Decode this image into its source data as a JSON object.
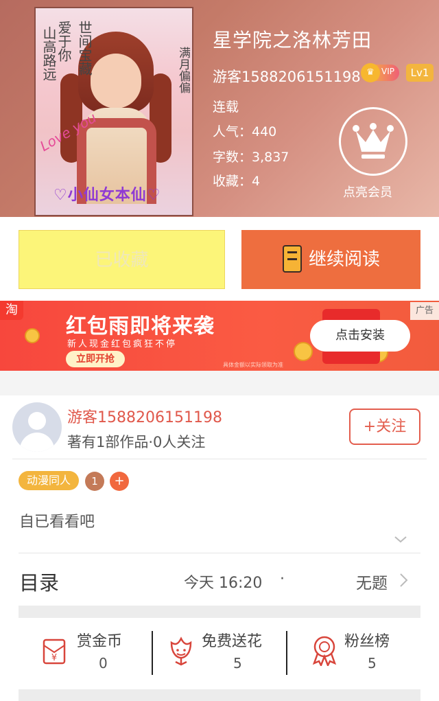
{
  "book": {
    "title": "星学院之洛林芳田",
    "author": "游客1588206151198",
    "vip_label": "VIP",
    "level": "Lv1",
    "status": "连载",
    "popularity": "人气：440",
    "word_count": "字数：3,837",
    "favorites": "收藏：4",
    "member_label": "点亮会员",
    "cover": {
      "line1": "山高路远",
      "line2": "爱于你",
      "line3": "世间宝藏",
      "line4": "满月偏偏",
      "love": "Love you",
      "banner": "♡小仙女本仙♡"
    }
  },
  "actions": {
    "collected": "已收藏",
    "continue": "继续阅读"
  },
  "ad": {
    "platform_icon": "淘",
    "headline": "红包雨即将来袭",
    "subline": "新人现金红包疯狂不停",
    "grab": "立即开抢",
    "install": "点击安装",
    "tag": "广告",
    "note": "具体金额以实际领取为准"
  },
  "author_card": {
    "name": "游客1588206151198",
    "meta": "著有1部作品·0人关注",
    "follow": "+关注",
    "category": "动漫同人",
    "tag_count": "1",
    "tag_add": "+",
    "description": "自已看看吧"
  },
  "toc": {
    "label": "目录",
    "time": "今天 16:20",
    "dot": "·",
    "latest": "无题"
  },
  "rewards": [
    {
      "label": "赏金币",
      "value": "0",
      "icon": "gold-coin-icon"
    },
    {
      "label": "免费送花",
      "value": "5",
      "icon": "flower-icon"
    },
    {
      "label": "粉丝榜",
      "value": "5",
      "icon": "medal-icon"
    }
  ],
  "colors": {
    "accent": "#ee6e3f",
    "collected_bg": "#fcf579",
    "author_name": "#e0584b",
    "tag": "#f3b53e"
  }
}
